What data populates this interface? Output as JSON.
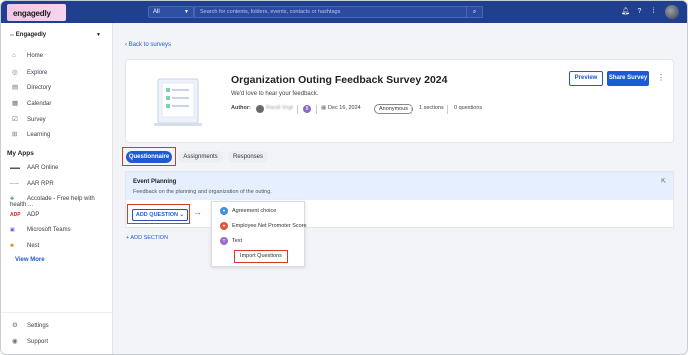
{
  "topbar": {
    "logo_text": "engagedly",
    "scope_value": "All",
    "search_placeholder": "Search for contents, folders, events, contacts or hashtags"
  },
  "sidebar": {
    "org_name": "Engagedly",
    "items": [
      {
        "label": "Home",
        "icon": "home-icon"
      },
      {
        "label": "Explore",
        "icon": "explore-icon"
      },
      {
        "label": "Directory",
        "icon": "directory-icon"
      },
      {
        "label": "Calendar",
        "icon": "calendar-icon"
      },
      {
        "label": "Survey",
        "icon": "survey-icon"
      },
      {
        "label": "Learning",
        "icon": "learning-icon"
      }
    ],
    "apps_title": "My Apps",
    "apps": [
      {
        "label": "AAR Online"
      },
      {
        "label": "AAR RPR"
      },
      {
        "label": "Accolade - Free help with health ..."
      },
      {
        "label": "ADP"
      },
      {
        "label": "Microsoft Teams"
      },
      {
        "label": "Nest"
      }
    ],
    "view_more": "View More",
    "footer": [
      {
        "label": "Settings",
        "icon": "gear-icon"
      },
      {
        "label": "Support",
        "icon": "support-icon"
      }
    ]
  },
  "main": {
    "back_link": "Back to surveys",
    "survey": {
      "title": "Organization Outing Feedback Survey 2024",
      "subtitle": "We'd love to hear your feedback.",
      "author_label": "Author:",
      "author_name": "Randi Vogt",
      "date": "Dec 16, 2024",
      "anonymity": "Anonymous",
      "sections": "1 sections",
      "questions": "0 questions",
      "preview_label": "Preview",
      "share_label": "Share Survey"
    },
    "tabs": [
      {
        "label": "Questionnaire",
        "active": true
      },
      {
        "label": "Assignments",
        "active": false
      },
      {
        "label": "Responses",
        "active": false
      }
    ],
    "section": {
      "title": "Event Planning",
      "description": "Feedback on the planning and organization of the outing.",
      "add_question_label": "ADD QUESTION"
    },
    "dropdown": [
      {
        "label": "Agreement choice",
        "color": "#3b8fe0"
      },
      {
        "label": "Employee Net Promoter Score",
        "color": "#e2553b"
      },
      {
        "label": "Text",
        "color": "#9b6bd0"
      }
    ],
    "import_label": "Import Questions",
    "add_section_label": "+ ADD SECTION"
  },
  "colors": {
    "topbar": "#1f3f8f",
    "primary": "#1d5bd6",
    "highlight": "#d23a2c",
    "section_header": "#e6efff"
  }
}
